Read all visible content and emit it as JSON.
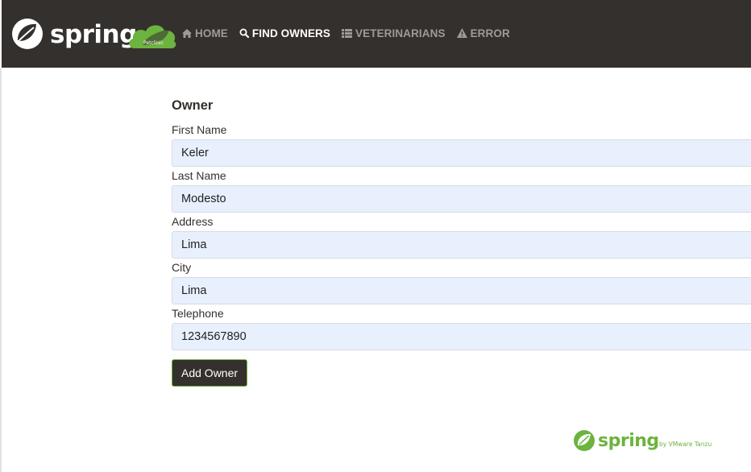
{
  "nav": {
    "brand_alt": "spring",
    "items": [
      {
        "label": "HOME",
        "icon": "home-icon",
        "active": false
      },
      {
        "label": "FIND OWNERS",
        "icon": "search-icon",
        "active": true
      },
      {
        "label": "VETERINARIANS",
        "icon": "list-icon",
        "active": false
      },
      {
        "label": "ERROR",
        "icon": "warning-icon",
        "active": false
      }
    ]
  },
  "form": {
    "title": "Owner",
    "fields": [
      {
        "label": "First Name",
        "value": "Keler"
      },
      {
        "label": "Last Name",
        "value": "Modesto"
      },
      {
        "label": "Address",
        "value": "Lima"
      },
      {
        "label": "City",
        "value": "Lima"
      },
      {
        "label": "Telephone",
        "value": "1234567890"
      }
    ],
    "submit_label": "Add Owner"
  },
  "footer": {
    "logo_text": "spring",
    "logo_sub": "by VMware Tanzu"
  },
  "colors": {
    "navbar_bg": "#34302d",
    "accent_green": "#6db33f",
    "input_bg": "#e8f0fe"
  }
}
